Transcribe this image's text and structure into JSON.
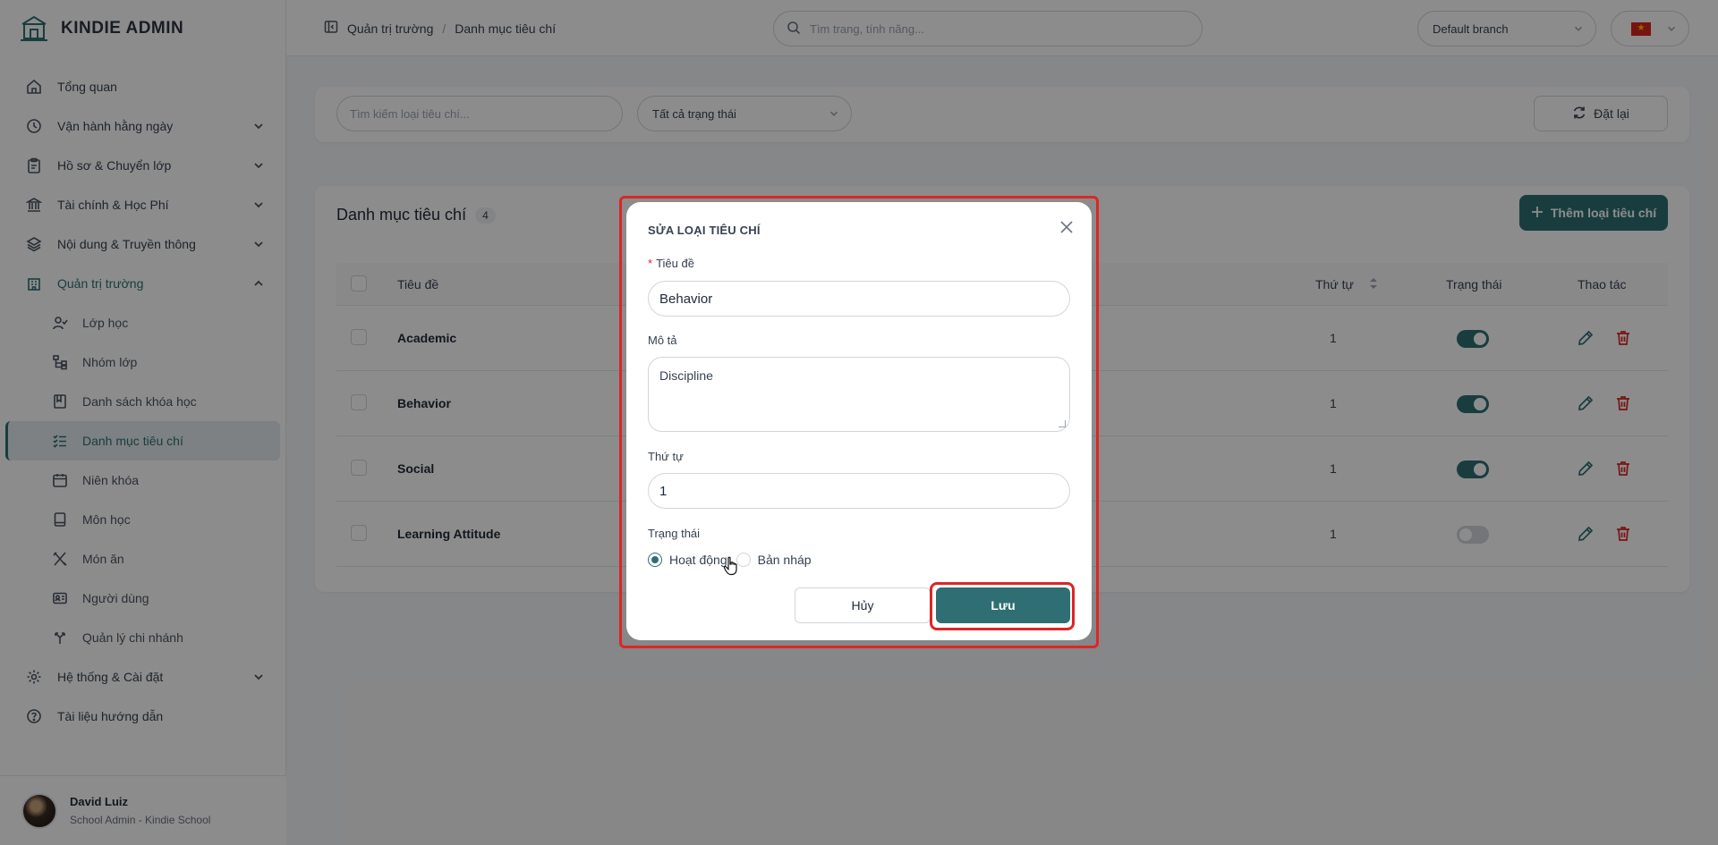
{
  "app": {
    "logo_text": "KINDIE ADMIN"
  },
  "sidebar": {
    "items": [
      {
        "label": "Tổng quan"
      },
      {
        "label": "Vận hành hằng ngày"
      },
      {
        "label": "Hồ sơ & Chuyển lớp"
      },
      {
        "label": "Tài chính & Học Phí"
      },
      {
        "label": "Nội dung & Truyền thông"
      },
      {
        "label": "Quản trị trường"
      }
    ],
    "sub_items": [
      {
        "label": "Lớp học"
      },
      {
        "label": "Nhóm lớp"
      },
      {
        "label": "Danh sách khóa học"
      },
      {
        "label": "Danh mục tiêu chí"
      },
      {
        "label": "Niên khóa"
      },
      {
        "label": "Môn học"
      },
      {
        "label": "Món ăn"
      },
      {
        "label": "Người dùng"
      },
      {
        "label": "Quản lý chi nhánh"
      }
    ],
    "bottom_items": [
      {
        "label": "Hệ thống & Cài đặt"
      },
      {
        "label": "Tài liệu hướng dẫn"
      }
    ],
    "user": {
      "name": "David Luiz",
      "role": "School Admin - Kindie School"
    }
  },
  "header": {
    "breadcrumb": [
      "Quản trị trường",
      "Danh mục tiêu chí"
    ],
    "breadcrumb_sep": "/",
    "search_placeholder": "Tìm trang, tính năng...",
    "branch": "Default branch",
    "flag_star": "★"
  },
  "filters": {
    "search_placeholder": "Tìm kiếm loại tiêu chí...",
    "status_select": "Tất cả trạng thái",
    "reset_label": "Đặt lại"
  },
  "table": {
    "title": "Danh mục tiêu chí",
    "count": "4",
    "add_label": "Thêm loại tiêu chí",
    "columns": {
      "title": "Tiêu đề",
      "order": "Thứ tự",
      "status": "Trạng thái",
      "actions": "Thao tác"
    },
    "rows": [
      {
        "title": "Academic",
        "order": "1",
        "active": true
      },
      {
        "title": "Behavior",
        "order": "1",
        "active": true
      },
      {
        "title": "Social",
        "order": "1",
        "active": true
      },
      {
        "title": "Learning Attitude",
        "order": "1",
        "active": false
      }
    ]
  },
  "modal": {
    "title": "SỬA LOẠI TIÊU CHÍ",
    "required_mark": "*",
    "title_label": "Tiêu đề",
    "title_value": "Behavior",
    "desc_label": "Mô tả",
    "desc_value": "Discipline",
    "order_label": "Thứ tự",
    "order_value": "1",
    "status_label": "Trạng thái",
    "status_active": "Hoạt động",
    "status_draft": "Bản nháp",
    "cancel_label": "Hủy",
    "save_label": "Lưu"
  },
  "colors": {
    "accent": "#2f6f73",
    "danger": "#dc2626"
  }
}
